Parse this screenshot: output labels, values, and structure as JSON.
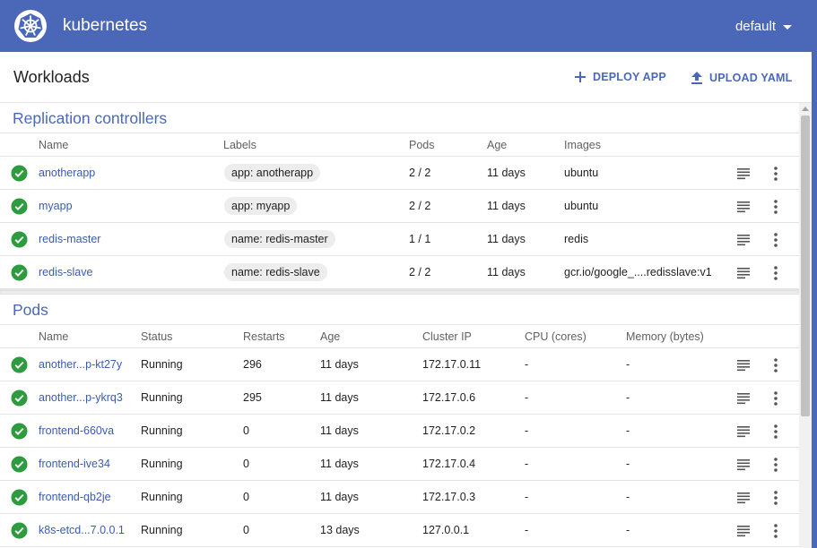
{
  "header": {
    "brand": "kubernetes",
    "namespace": "default"
  },
  "toolbar": {
    "title": "Workloads",
    "deploy_label": "DEPLOY APP",
    "upload_label": "UPLOAD YAML"
  },
  "replication_controllers": {
    "title": "Replication controllers",
    "columns": {
      "name": "Name",
      "labels": "Labels",
      "pods": "Pods",
      "age": "Age",
      "images": "Images"
    },
    "rows": [
      {
        "name": "anotherapp",
        "label": "app: anotherapp",
        "pods": "2 / 2",
        "age": "11 days",
        "image": "ubuntu"
      },
      {
        "name": "myapp",
        "label": "app: myapp",
        "pods": "2 / 2",
        "age": "11 days",
        "image": "ubuntu"
      },
      {
        "name": "redis-master",
        "label": "name: redis-master",
        "pods": "1 / 1",
        "age": "11 days",
        "image": "redis"
      },
      {
        "name": "redis-slave",
        "label": "name: redis-slave",
        "pods": "2 / 2",
        "age": "11 days",
        "image": "gcr.io/google_....redisslave:v1"
      }
    ]
  },
  "pods": {
    "title": "Pods",
    "columns": {
      "name": "Name",
      "status": "Status",
      "restarts": "Restarts",
      "age": "Age",
      "cluster_ip": "Cluster IP",
      "cpu": "CPU (cores)",
      "memory": "Memory (bytes)"
    },
    "rows": [
      {
        "name": "another...p-kt27y",
        "status": "Running",
        "restarts": "296",
        "age": "11 days",
        "ip": "172.17.0.11",
        "cpu": "-",
        "memory": "-"
      },
      {
        "name": "another...p-ykrq3",
        "status": "Running",
        "restarts": "295",
        "age": "11 days",
        "ip": "172.17.0.6",
        "cpu": "-",
        "memory": "-"
      },
      {
        "name": "frontend-660va",
        "status": "Running",
        "restarts": "0",
        "age": "11 days",
        "ip": "172.17.0.2",
        "cpu": "-",
        "memory": "-"
      },
      {
        "name": "frontend-ive34",
        "status": "Running",
        "restarts": "0",
        "age": "11 days",
        "ip": "172.17.0.4",
        "cpu": "-",
        "memory": "-"
      },
      {
        "name": "frontend-qb2je",
        "status": "Running",
        "restarts": "0",
        "age": "11 days",
        "ip": "172.17.0.3",
        "cpu": "-",
        "memory": "-"
      },
      {
        "name": "k8s-etcd...7.0.0.1",
        "status": "Running",
        "restarts": "0",
        "age": "13 days",
        "ip": "127.0.0.1",
        "cpu": "-",
        "memory": "-"
      }
    ]
  },
  "icons": {
    "status": "check-circle-icon",
    "logs": "logs-icon",
    "menu": "more-vert-icon"
  },
  "colors": {
    "primary": "#4a68b7",
    "success": "#2e9b3f"
  }
}
